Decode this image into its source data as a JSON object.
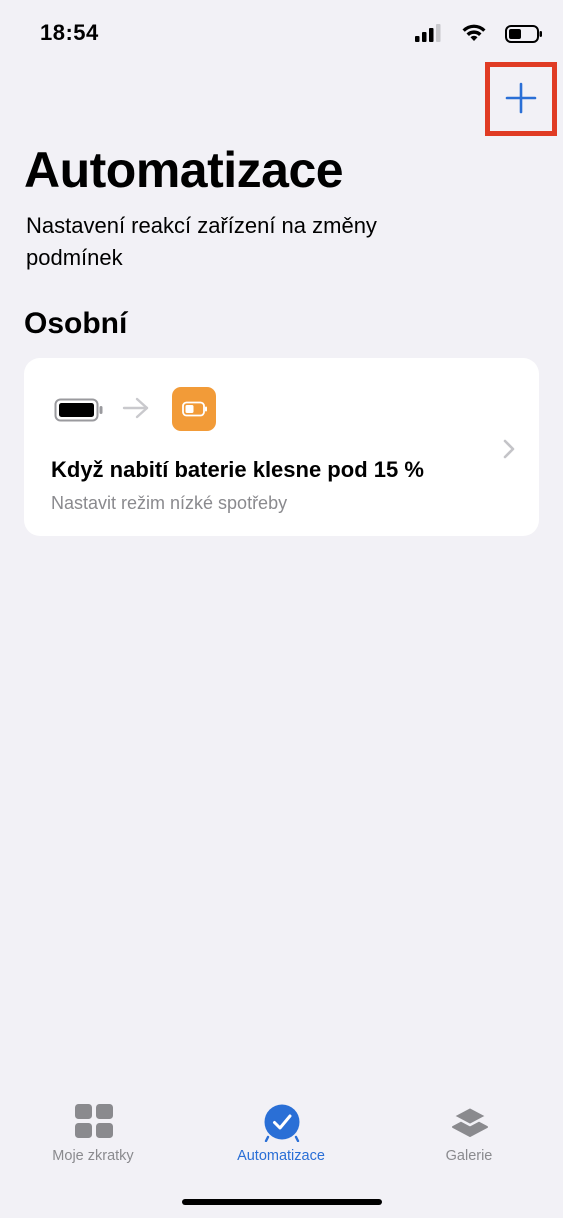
{
  "status_bar": {
    "time": "18:54",
    "icons": [
      "signal-icon",
      "wifi-icon",
      "battery-icon"
    ]
  },
  "header": {
    "add_icon": "plus-icon",
    "title": "Automatizace",
    "subtitle": "Nastavení reakcí zařízení na změny podmínek"
  },
  "section": {
    "title": "Osobní"
  },
  "automation": {
    "trigger_icon": "battery-icon",
    "action_icon": "low-power-battery-icon",
    "title": "Když nabití baterie klesne pod 15 %",
    "subtitle": "Nastavit režim nízké spotřeby"
  },
  "tab_bar": {
    "tabs": [
      {
        "label": "Moje zkratky",
        "icon": "grid-icon",
        "active": false
      },
      {
        "label": "Automatizace",
        "icon": "clock-check-icon",
        "active": true
      },
      {
        "label": "Galerie",
        "icon": "layers-icon",
        "active": false
      }
    ]
  },
  "colors": {
    "accent": "#2a6fd6",
    "background": "#f2f1f6",
    "action_orange": "#f29b38",
    "highlight_red": "#e03b24"
  }
}
